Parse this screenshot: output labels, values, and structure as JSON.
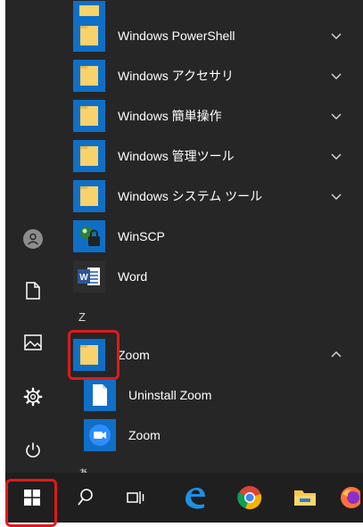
{
  "apps": [
    {
      "label": "Windows PowerShell",
      "icon": "folder-icon",
      "expandable": true,
      "expanded": false
    },
    {
      "label": "Windows アクセサリ",
      "icon": "folder-icon",
      "expandable": true,
      "expanded": false
    },
    {
      "label": "Windows 簡単操作",
      "icon": "folder-icon",
      "expandable": true,
      "expanded": false
    },
    {
      "label": "Windows 管理ツール",
      "icon": "folder-icon",
      "expandable": true,
      "expanded": false
    },
    {
      "label": "Windows システム ツール",
      "icon": "folder-icon",
      "expandable": true,
      "expanded": false
    },
    {
      "label": "WinSCP",
      "icon": "winscp-icon",
      "expandable": false
    },
    {
      "label": "Word",
      "icon": "word-icon",
      "expandable": false
    }
  ],
  "section_letter": "Z",
  "zoom_folder": {
    "label": "Zoom",
    "icon": "folder-icon",
    "expanded": true
  },
  "zoom_children": [
    {
      "label": "Uninstall Zoom",
      "icon": "document-icon"
    },
    {
      "label": "Zoom",
      "icon": "zoom-camera-icon"
    }
  ],
  "next_letter": "あ",
  "word_tile_text": "W",
  "sidebar_icons": [
    "user-avatar-icon",
    "documents-icon",
    "pictures-icon",
    "settings-gear-icon",
    "power-icon"
  ],
  "taskbar_icons": [
    "windows-start-icon",
    "search-icon",
    "task-view-icon",
    "edge-icon",
    "chrome-icon",
    "file-explorer-icon",
    "firefox-icon"
  ],
  "colors": {
    "menu_bg": "#262626",
    "tile_blue": "#0f6fc6",
    "folder_yellow": "#f8d26a",
    "highlight_red": "#e0191c",
    "taskbar_bg": "#1f1f1f"
  }
}
